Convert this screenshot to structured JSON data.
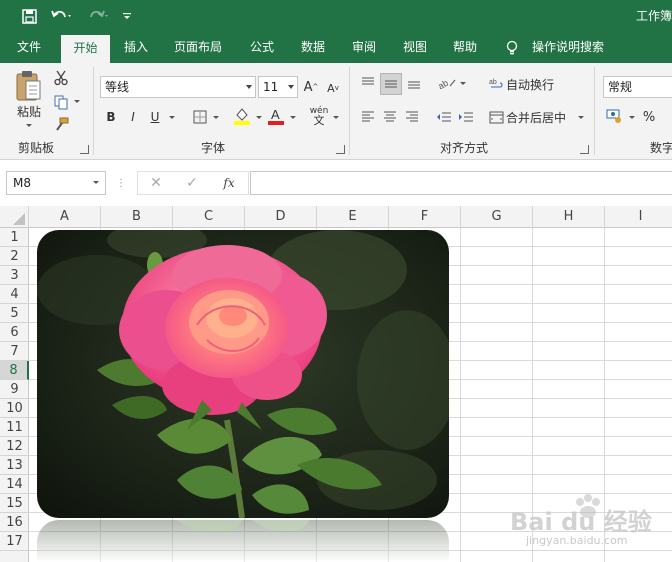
{
  "titlebar": {
    "title": "工作簿",
    "icons": [
      "save-icon",
      "undo-icon",
      "redo-icon",
      "customize-quick-access-icon"
    ]
  },
  "tabs": [
    {
      "label": "文件"
    },
    {
      "label": "开始"
    },
    {
      "label": "插入"
    },
    {
      "label": "页面布局"
    },
    {
      "label": "公式"
    },
    {
      "label": "数据"
    },
    {
      "label": "审阅"
    },
    {
      "label": "视图"
    },
    {
      "label": "帮助"
    },
    {
      "label": "操作说明搜索"
    }
  ],
  "ribbon": {
    "clipboard": {
      "paste_label": "粘贴",
      "group_label": "剪贴板"
    },
    "font": {
      "font_name": "等线",
      "font_size": "11",
      "bold": "B",
      "italic": "I",
      "underline": "U",
      "group_label": "字体",
      "phonetic_glyph": "wén"
    },
    "alignment": {
      "wrap_text": "自动换行",
      "merge_center": "合并后居中",
      "group_label": "对齐方式"
    },
    "number": {
      "format": "常规",
      "percent": "%",
      "group_label": "数字"
    }
  },
  "formula_bar": {
    "name_box": "M8",
    "fx": "fx",
    "formula": ""
  },
  "columns": [
    "A",
    "B",
    "C",
    "D",
    "E",
    "F",
    "G",
    "H",
    "I"
  ],
  "rows": [
    "1",
    "2",
    "3",
    "4",
    "5",
    "6",
    "7",
    "8",
    "9",
    "10",
    "11",
    "12",
    "13",
    "14",
    "15",
    "16",
    "17"
  ],
  "selected_row": "8",
  "colors": {
    "accent": "#217346",
    "ribbon_bg": "#f3f3f3"
  },
  "watermark": {
    "main": "Bai du 经验",
    "sub": "jingyan.baidu.com"
  }
}
